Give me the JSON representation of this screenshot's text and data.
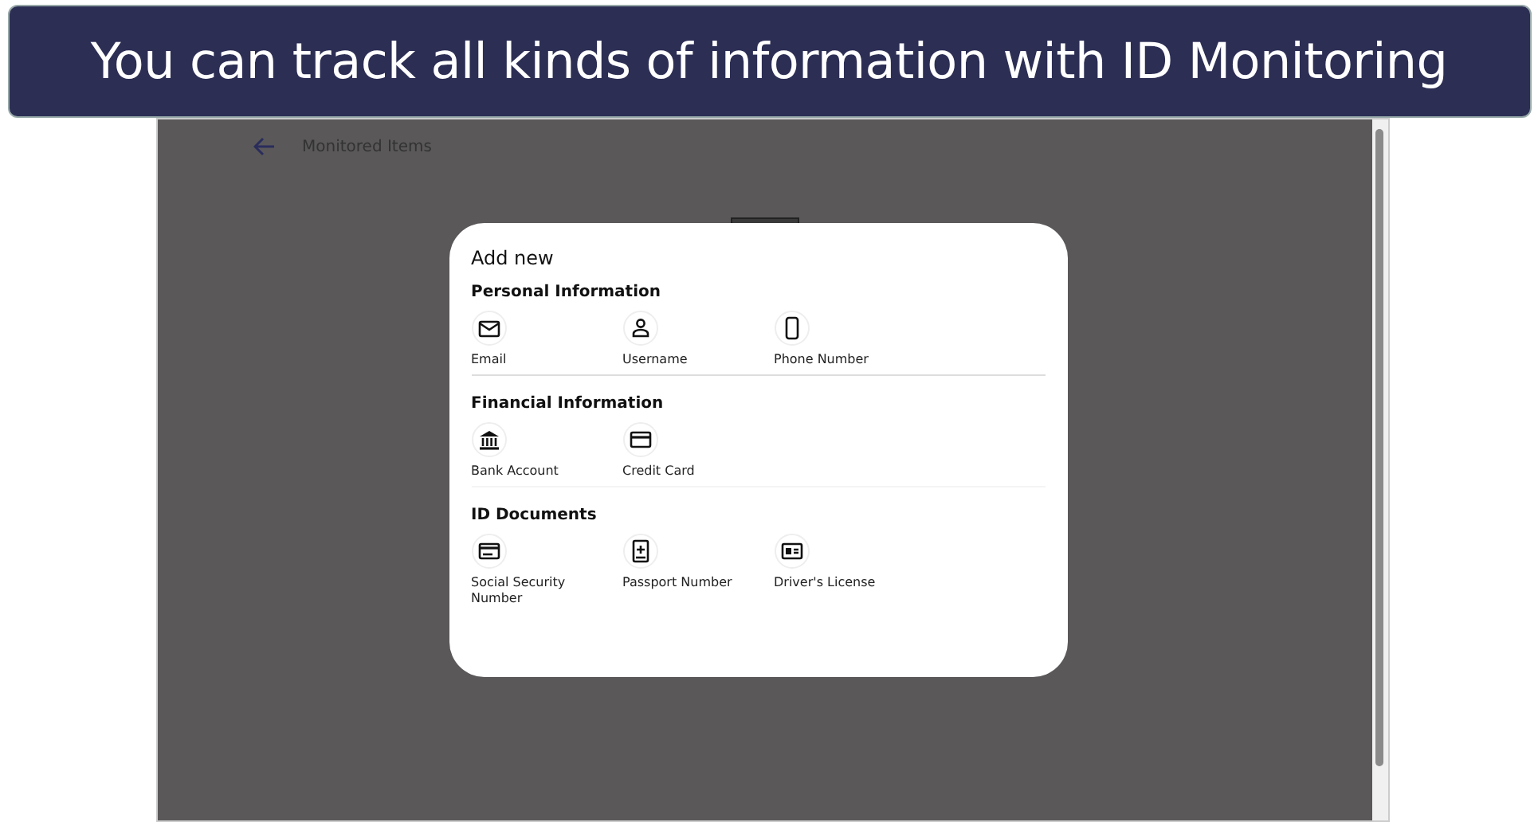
{
  "banner": {
    "title": "You can track all kinds of information with ID Monitoring"
  },
  "page": {
    "title": "Monitored Items"
  },
  "dialog": {
    "title": "Add new",
    "sections": [
      {
        "title": "Personal Information",
        "items": [
          {
            "label": "Email",
            "kind": "email"
          },
          {
            "label": "Username",
            "kind": "user"
          },
          {
            "label": "Phone Number",
            "kind": "phone"
          }
        ]
      },
      {
        "title": "Financial Information",
        "items": [
          {
            "label": "Bank Account",
            "kind": "bank"
          },
          {
            "label": "Credit Card",
            "kind": "card"
          }
        ]
      },
      {
        "title": "ID Documents",
        "items": [
          {
            "label": "Social Security Number",
            "kind": "ssn"
          },
          {
            "label": "Passport Number",
            "kind": "passport"
          },
          {
            "label": "Driver's License",
            "kind": "license"
          }
        ]
      }
    ]
  }
}
